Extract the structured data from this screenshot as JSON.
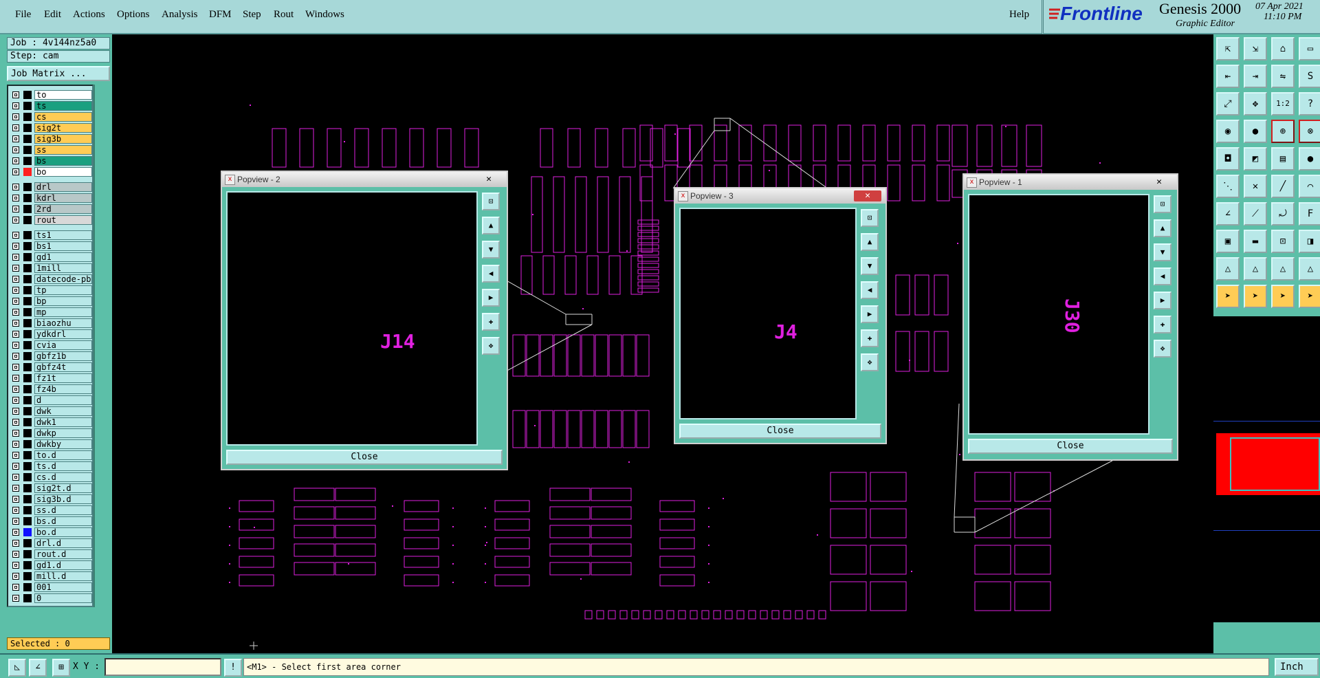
{
  "menu": {
    "items": [
      "File",
      "Edit",
      "Actions",
      "Options",
      "Analysis",
      "DFM",
      "Step",
      "Rout",
      "Windows"
    ],
    "help": "Help"
  },
  "brand": {
    "logo": "Frontline",
    "product": "Genesis 2000",
    "subtitle": "Graphic Editor",
    "date": "07 Apr 2021",
    "time": "11:10 PM"
  },
  "job": {
    "job_label": "Job : 4v144nz5a0",
    "step_label": "Step: cam",
    "matrix_button": "Job Matrix ..."
  },
  "layers": [
    {
      "name": "to",
      "color": "#ffffff"
    },
    {
      "name": "ts",
      "color": "#1aa080"
    },
    {
      "name": "cs",
      "color": "#ffcc55"
    },
    {
      "name": "sig2t",
      "color": "#ffcc55"
    },
    {
      "name": "sig3b",
      "color": "#ffcc55"
    },
    {
      "name": "ss",
      "color": "#ffcc55"
    },
    {
      "name": "bs",
      "color": "#1aa080"
    },
    {
      "name": "bo",
      "color": "#ffffff",
      "active": true
    },
    {
      "name": "drl",
      "color": "#b8c8c8"
    },
    {
      "name": "kdrl",
      "color": "#b8c8c8"
    },
    {
      "name": "2rd",
      "color": "#b8c8c8"
    },
    {
      "name": "rout",
      "color": "#d8d8d8"
    },
    {
      "name": "ts1",
      "color": "#b8e8e8"
    },
    {
      "name": "bs1",
      "color": "#b8e8e8"
    },
    {
      "name": "gd1",
      "color": "#b8e8e8"
    },
    {
      "name": "1mill",
      "color": "#b8e8e8"
    },
    {
      "name": "datecode-pbe",
      "color": "#b8e8e8"
    },
    {
      "name": "tp",
      "color": "#b8e8e8"
    },
    {
      "name": "bp",
      "color": "#b8e8e8"
    },
    {
      "name": "mp",
      "color": "#b8e8e8"
    },
    {
      "name": "biaozhu",
      "color": "#b8e8e8"
    },
    {
      "name": "ydkdrl",
      "color": "#b8e8e8"
    },
    {
      "name": "cvia",
      "color": "#b8e8e8"
    },
    {
      "name": "gbfz1b",
      "color": "#b8e8e8"
    },
    {
      "name": "gbfz4t",
      "color": "#b8e8e8"
    },
    {
      "name": "fz1t",
      "color": "#b8e8e8"
    },
    {
      "name": "fz4b",
      "color": "#b8e8e8"
    },
    {
      "name": "d",
      "color": "#b8e8e8"
    },
    {
      "name": "dwk",
      "color": "#b8e8e8"
    },
    {
      "name": "dwk1",
      "color": "#b8e8e8"
    },
    {
      "name": "dwkp",
      "color": "#b8e8e8"
    },
    {
      "name": "dwkby",
      "color": "#b8e8e8"
    },
    {
      "name": "to.d",
      "color": "#b8e8e8"
    },
    {
      "name": "ts.d",
      "color": "#b8e8e8"
    },
    {
      "name": "cs.d",
      "color": "#b8e8e8"
    },
    {
      "name": "sig2t.d",
      "color": "#b8e8e8"
    },
    {
      "name": "sig3b.d",
      "color": "#b8e8e8"
    },
    {
      "name": "ss.d",
      "color": "#b8e8e8"
    },
    {
      "name": "bs.d",
      "color": "#b8e8e8"
    },
    {
      "name": "bo.d",
      "color": "#b8e8e8"
    },
    {
      "name": "drl.d",
      "color": "#b8e8e8"
    },
    {
      "name": "rout.d",
      "color": "#b8e8e8"
    },
    {
      "name": "gd1.d",
      "color": "#b8e8e8"
    },
    {
      "name": "mill.d",
      "color": "#b8e8e8"
    },
    {
      "name": "001",
      "color": "#b8e8e8"
    },
    {
      "name": "0",
      "color": "#b8e8e8"
    }
  ],
  "selected": "Selected : 0",
  "popups": [
    {
      "title": "Popview - 2",
      "designator": "J14",
      "close": "Close",
      "x_glyph": "✕"
    },
    {
      "title": "Popview - 3",
      "designator": "J4",
      "close": "Close",
      "x_glyph": "✕"
    },
    {
      "title": "Popview - 1",
      "designator": "J30",
      "close": "Close",
      "x_glyph": "✕"
    }
  ],
  "status": {
    "xy_label": "X Y :",
    "xy_value": "",
    "prompt": "<M1> - Select first area corner",
    "units": "Inch"
  },
  "colors": {
    "panel": "#5cbfa8",
    "panel_light": "#b8e8e8",
    "trace": "#e020e0",
    "red_view": "#ff0000"
  }
}
